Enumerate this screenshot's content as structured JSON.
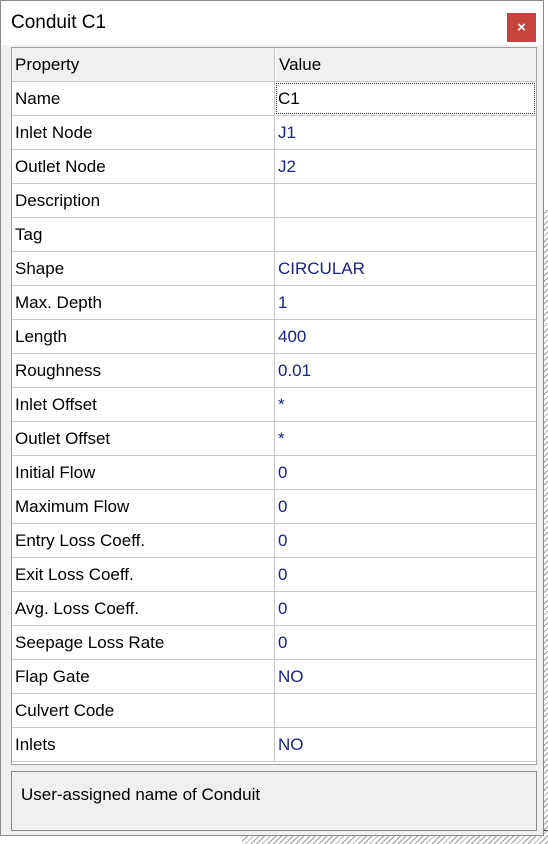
{
  "window": {
    "title": "Conduit C1",
    "close_label": "×"
  },
  "grid": {
    "headers": {
      "property": "Property",
      "value": "Value"
    },
    "rows": [
      {
        "property": "Name",
        "value": "C1"
      },
      {
        "property": "Inlet Node",
        "value": "J1"
      },
      {
        "property": "Outlet Node",
        "value": "J2"
      },
      {
        "property": "Description",
        "value": ""
      },
      {
        "property": "Tag",
        "value": ""
      },
      {
        "property": "Shape",
        "value": "CIRCULAR"
      },
      {
        "property": "Max. Depth",
        "value": "1"
      },
      {
        "property": "Length",
        "value": "400"
      },
      {
        "property": "Roughness",
        "value": "0.01"
      },
      {
        "property": "Inlet Offset",
        "value": "*"
      },
      {
        "property": "Outlet Offset",
        "value": "*"
      },
      {
        "property": "Initial Flow",
        "value": "0"
      },
      {
        "property": "Maximum Flow",
        "value": "0"
      },
      {
        "property": "Entry Loss Coeff.",
        "value": "0"
      },
      {
        "property": "Exit Loss Coeff.",
        "value": "0"
      },
      {
        "property": "Avg. Loss Coeff.",
        "value": "0"
      },
      {
        "property": "Seepage Loss Rate",
        "value": "0"
      },
      {
        "property": "Flap Gate",
        "value": "NO"
      },
      {
        "property": "Culvert Code",
        "value": ""
      },
      {
        "property": "Inlets",
        "value": "NO"
      }
    ]
  },
  "description": {
    "text": "User-assigned name of Conduit"
  },
  "colors": {
    "close_button": "#c6433e",
    "value_text": "#1a237e"
  }
}
